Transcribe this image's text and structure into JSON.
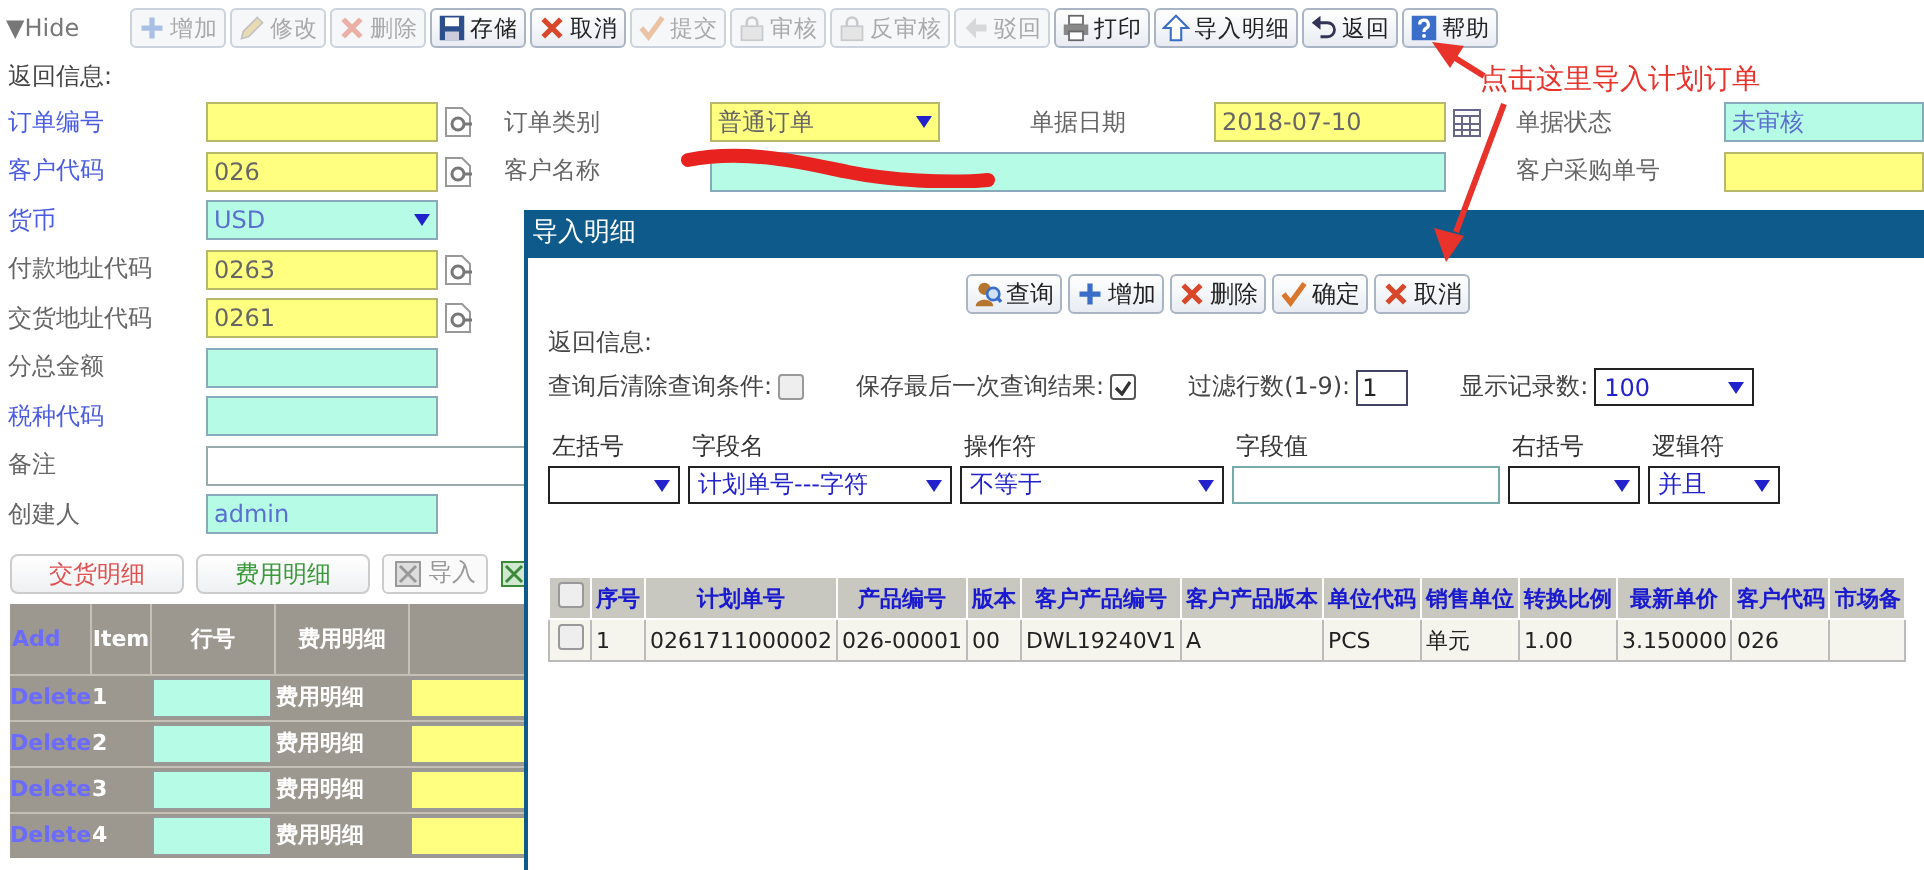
{
  "toolbar": {
    "toggle": "▼",
    "label": "Hide",
    "buttons": [
      {
        "label": "增加",
        "kind": "plus",
        "disabled": true
      },
      {
        "label": "修改",
        "kind": "pencil",
        "disabled": true
      },
      {
        "label": "删除",
        "kind": "cross",
        "disabled": true
      },
      {
        "label": "存储",
        "kind": "floppy",
        "disabled": false
      },
      {
        "label": "取消",
        "kind": "cross",
        "disabled": false
      },
      {
        "label": "提交",
        "kind": "check",
        "disabled": true
      },
      {
        "label": "审核",
        "kind": "lock",
        "disabled": true
      },
      {
        "label": "反审核",
        "kind": "lock",
        "disabled": true
      },
      {
        "label": "驳回",
        "kind": "leftarrow",
        "disabled": true
      },
      {
        "label": "打印",
        "kind": "printer",
        "disabled": false
      },
      {
        "label": "导入明细",
        "kind": "uparrow",
        "disabled": false
      },
      {
        "label": "返回",
        "kind": "undo",
        "disabled": false
      },
      {
        "label": "帮助",
        "kind": "question",
        "disabled": false
      }
    ]
  },
  "annotation": {
    "text": "点击这里导入计划订单"
  },
  "form": {
    "return_info": "返回信息:",
    "rows": [
      {
        "fields": [
          {
            "label": "订单编号",
            "link": true,
            "kind": "lookup",
            "required": true
          },
          {
            "label": "订单类别",
            "link": false,
            "kind": "select",
            "value": "普通订单",
            "required": true
          },
          {
            "label": "单据日期",
            "link": false,
            "kind": "date",
            "value": "2018-07-10",
            "required": true
          },
          {
            "label": "单据状态",
            "link": false,
            "kind": "text",
            "value": "未审核",
            "readonly": true
          }
        ]
      },
      {
        "fields": [
          {
            "label": "客户代码",
            "link": true,
            "kind": "lookup",
            "value": "026",
            "required": true
          },
          {
            "label": "客户名称",
            "link": false,
            "kind": "wide",
            "readonly": true
          },
          {
            "label": "客户采购单号",
            "link": false,
            "kind": "text",
            "required": true
          }
        ]
      },
      {
        "fields": [
          {
            "label": "货币",
            "link": true,
            "kind": "select",
            "value": "USD",
            "readonly": true
          }
        ]
      },
      {
        "fields": [
          {
            "label": "付款地址代码",
            "link": false,
            "kind": "lookup",
            "value": "0263",
            "required": true
          }
        ]
      },
      {
        "fields": [
          {
            "label": "交货地址代码",
            "link": false,
            "kind": "lookup",
            "value": "0261",
            "required": true
          }
        ]
      },
      {
        "fields": [
          {
            "label": "分总金额",
            "link": false,
            "kind": "text",
            "readonly": true
          }
        ]
      },
      {
        "fields": [
          {
            "label": "税种代码",
            "link": true,
            "kind": "text",
            "readonly": true
          }
        ]
      },
      {
        "fields": [
          {
            "label": "备注",
            "link": false,
            "kind": "wide"
          }
        ]
      },
      {
        "fields": [
          {
            "label": "创建人",
            "link": false,
            "kind": "text",
            "value": "admin",
            "readonly": true
          }
        ]
      }
    ]
  },
  "detail_tabs": [
    {
      "label": "交货明细",
      "selected": true
    },
    {
      "label": "费用明细",
      "selected": false
    }
  ],
  "import_button": {
    "label": "导入",
    "disabled": true
  },
  "detail_grid": {
    "columns": [
      "Add",
      "Item",
      "行号",
      "费用明细"
    ],
    "rows": [
      {
        "action": "Delete",
        "item": "1",
        "type": "费用明细"
      },
      {
        "action": "Delete",
        "item": "2",
        "type": "费用明细"
      },
      {
        "action": "Delete",
        "item": "3",
        "type": "费用明细"
      },
      {
        "action": "Delete",
        "item": "4",
        "type": "费用明细"
      }
    ]
  },
  "dialog": {
    "title": "导入明细",
    "buttons": [
      {
        "label": "查询",
        "kind": "search"
      },
      {
        "label": "增加",
        "kind": "plus"
      },
      {
        "label": "删除",
        "kind": "cross"
      },
      {
        "label": "确定",
        "kind": "check"
      },
      {
        "label": "取消",
        "kind": "cross"
      }
    ],
    "return_info": "返回信息:",
    "options": [
      {
        "label": "查询后清除查询条件:",
        "kind": "checkbox",
        "checked": false
      },
      {
        "label": "保存最后一次查询结果:",
        "kind": "checkbox",
        "checked": true
      },
      {
        "label": "过滤行数(1-9):",
        "kind": "input",
        "value": "1"
      },
      {
        "label": "显示记录数:",
        "kind": "select",
        "value": "100"
      }
    ],
    "filters": [
      {
        "label": "左括号",
        "kind": "select"
      },
      {
        "label": "字段名",
        "kind": "select",
        "value": "计划单号---字符"
      },
      {
        "label": "操作符",
        "kind": "select",
        "value": "不等于"
      },
      {
        "label": "字段值",
        "kind": "input"
      },
      {
        "label": "右括号",
        "kind": "select"
      },
      {
        "label": "逻辑符",
        "kind": "select",
        "value": "并且"
      }
    ],
    "table": {
      "all_checked": false,
      "columns": [
        "序号",
        "计划单号",
        "产品编号",
        "版本",
        "客户产品编号",
        "客户产品版本",
        "单位代码",
        "销售单位",
        "转换比例",
        "最新单价",
        "客户代码",
        "市场备"
      ],
      "rows": [
        {
          "checked": false,
          "cells": [
            "1",
            "0261711000002",
            "026-00001",
            "00",
            "DWL19240V1",
            "A",
            "PCS",
            "单元",
            "1.00",
            "3.150000",
            "026",
            null
          ]
        }
      ]
    }
  }
}
